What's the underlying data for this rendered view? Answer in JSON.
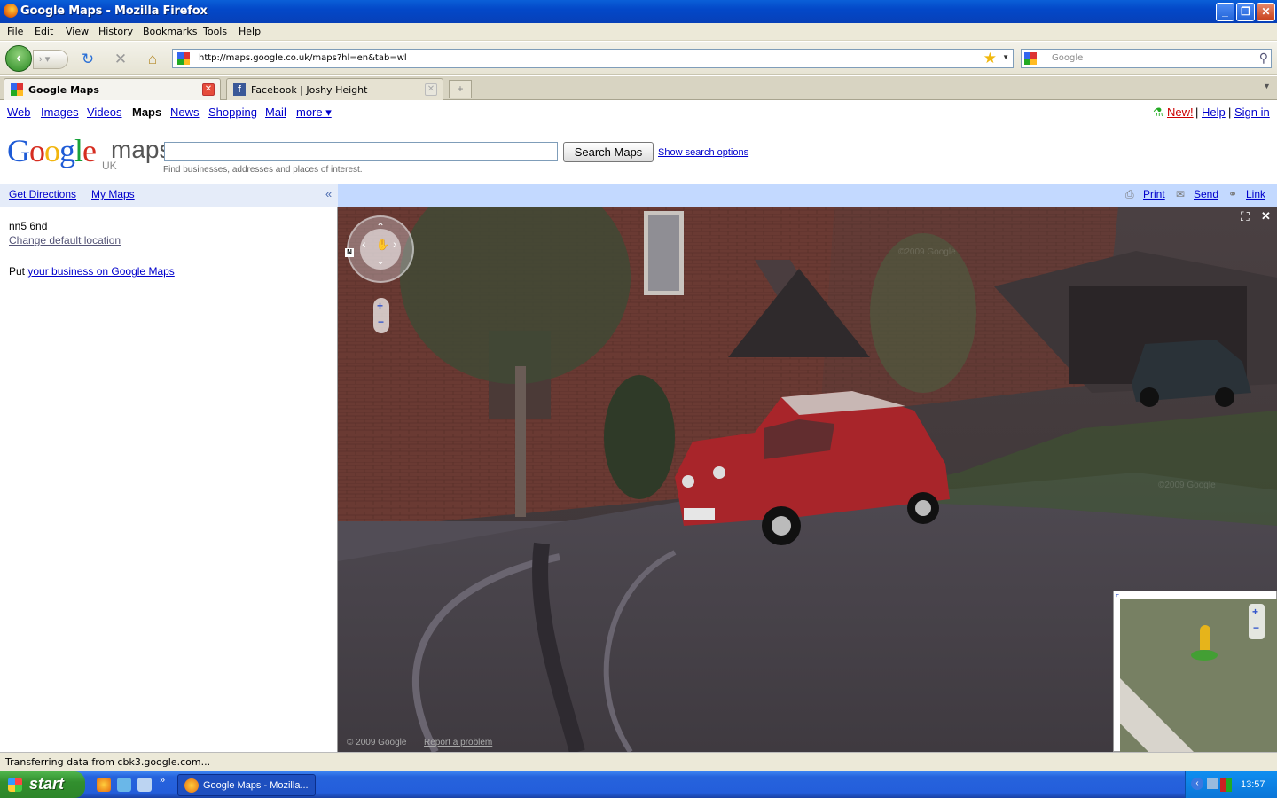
{
  "window": {
    "title": "Google Maps - Mozilla Firefox"
  },
  "menu": [
    "File",
    "Edit",
    "View",
    "History",
    "Bookmarks",
    "Tools",
    "Help"
  ],
  "nav": {
    "url": "http://maps.google.co.uk/maps?hl=en&tab=wl",
    "search_placeholder": "Google"
  },
  "tabs": [
    {
      "label": "Google Maps",
      "active": true
    },
    {
      "label": "Facebook | Joshy Height",
      "active": false
    }
  ],
  "gbar": {
    "links": [
      "Web",
      "Images",
      "Videos",
      "Maps",
      "News",
      "Shopping",
      "Mail",
      "more ▾"
    ],
    "selected": "Maps",
    "right": {
      "new": "New!",
      "help": "Help",
      "signin": "Sign in"
    }
  },
  "search": {
    "logo_main": "Google",
    "logo_maps": "maps",
    "logo_region": "UK",
    "button": "Search Maps",
    "options": "Show search options",
    "hint": "Find businesses, addresses and places of interest."
  },
  "left_panel": {
    "get_directions": "Get Directions",
    "my_maps": "My Maps",
    "collapse": "«",
    "location": "nn5 6nd",
    "change_location": "Change default location",
    "put": "Put",
    "business_link": "your business on Google Maps"
  },
  "map_toolbar": {
    "print": "Print",
    "send": "Send",
    "link": "Link"
  },
  "streetview": {
    "copyright": "© 2009 Google",
    "report": "Report a problem",
    "compass_n": "N",
    "watermark": "©2009 Google"
  },
  "status": "Transferring data from cbk3.google.com...",
  "taskbar": {
    "start": "start",
    "item": "Google Maps - Mozilla...",
    "clock": "13:57"
  }
}
